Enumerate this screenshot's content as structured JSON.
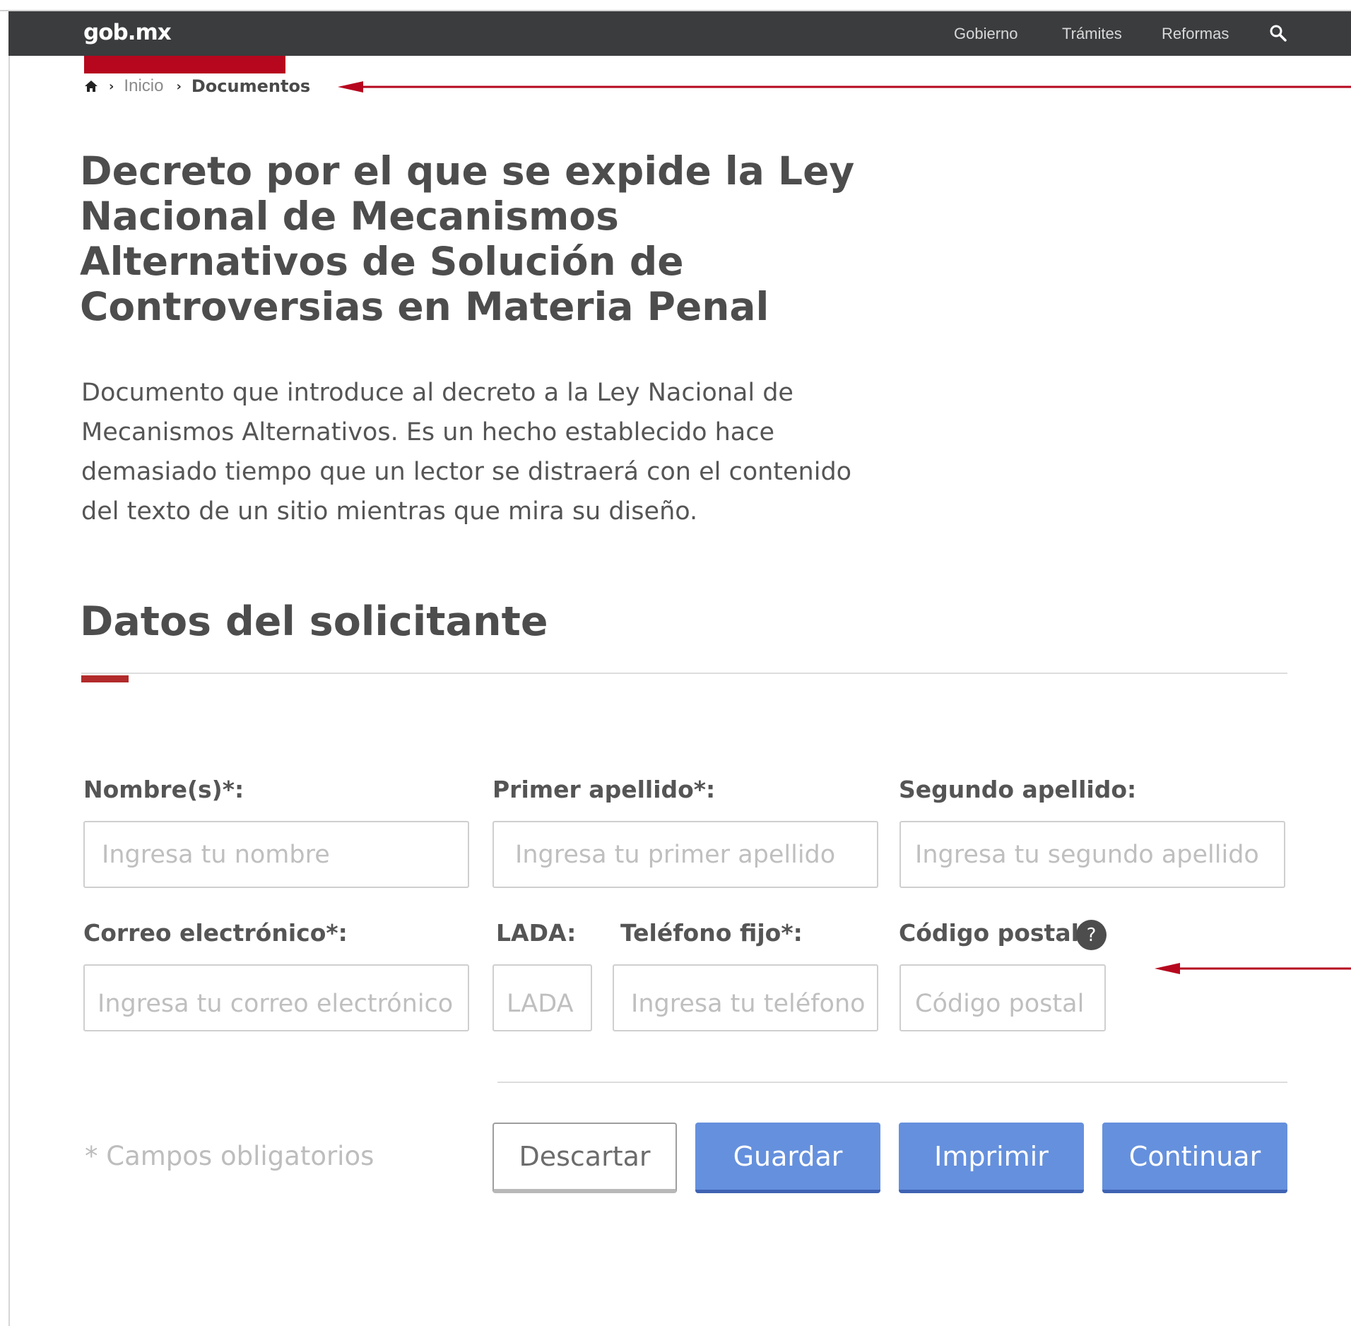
{
  "navbar": {
    "logo_left": "gob",
    "logo_dot": ".",
    "logo_right": "mx",
    "items": [
      "Gobierno",
      "Trámites",
      "Reformas"
    ],
    "search_icon": "search-icon"
  },
  "breadcrumb": {
    "home_icon": "home-icon",
    "items": [
      "Inicio",
      "Documentos"
    ]
  },
  "page": {
    "title": "Decreto por el que se expide la Ley Nacional de Mecanismos Alternativos de Solución de Controversias en Materia Penal",
    "intro": "Documento que introduce al decreto a la Ley Nacional de Mecanismos Alternativos. Es un hecho establecido hace demasiado tiempo que un lector se distraerá con el contenido del texto de un sitio mientras que mira su diseño."
  },
  "section": {
    "title": "Datos del solicitante"
  },
  "form": {
    "nombre": {
      "label": "Nombre(s)*:",
      "placeholder": "Ingresa tu nombre"
    },
    "primer_apellido": {
      "label": "Primer apellido*:",
      "placeholder": "Ingresa tu primer apellido"
    },
    "segundo_apellido": {
      "label": "Segundo apellido:",
      "placeholder": "Ingresa tu segundo apellido"
    },
    "correo": {
      "label": "Correo electrónico*:",
      "placeholder": "Ingresa tu correo electrónico"
    },
    "lada": {
      "label": "LADA:",
      "placeholder": "LADA"
    },
    "telefono": {
      "label": "Teléfono fijo*:",
      "placeholder": "Ingresa tu teléfono"
    },
    "codigo_postal": {
      "label": "Código postal:",
      "placeholder": "Código postal",
      "help": "?"
    },
    "required_note": "* Campos obligatorios"
  },
  "buttons": {
    "discard": "Descartar",
    "save": "Guardar",
    "print": "Imprimir",
    "continue": "Continuar"
  },
  "colors": {
    "navbar": "#3b3c3e",
    "accent_red": "#b6071e",
    "primary_button": "#6590dd"
  }
}
